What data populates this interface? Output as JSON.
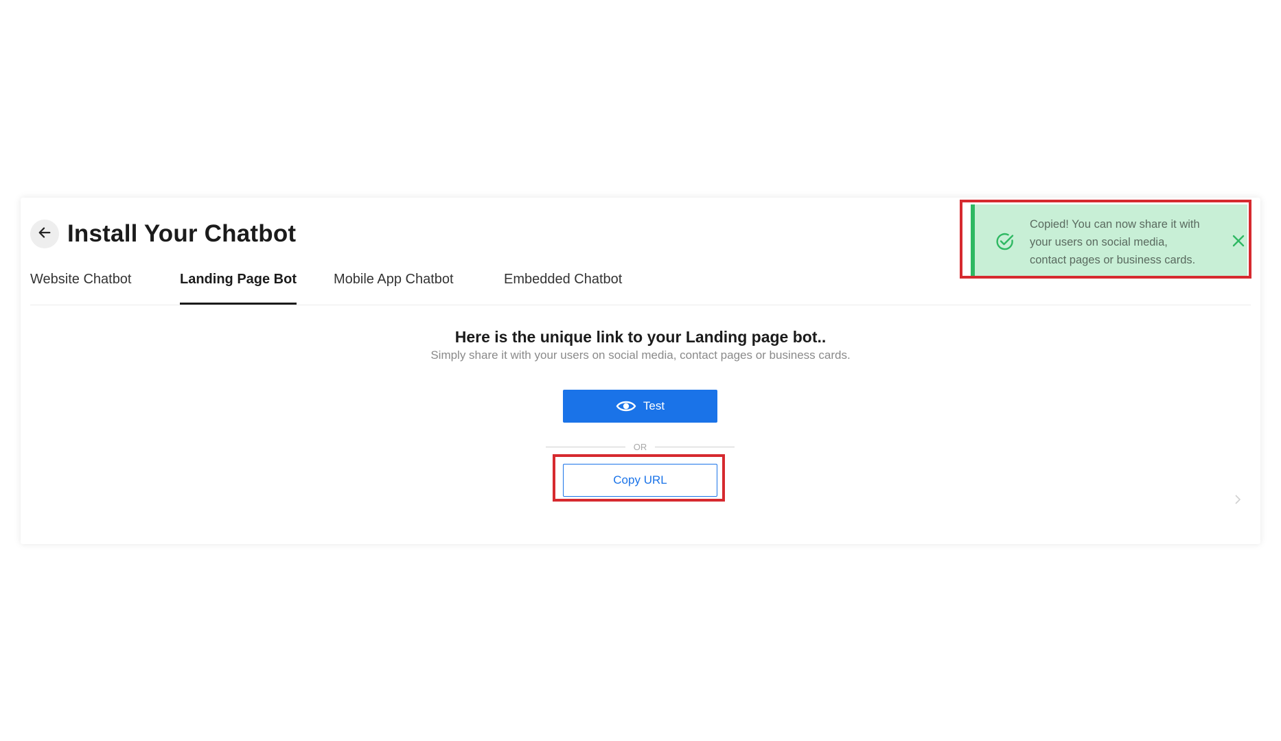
{
  "header": {
    "back_icon": "arrow-left-icon",
    "title": "Install Your Chatbot"
  },
  "tabs": [
    {
      "label": "Website Chatbot",
      "active": false
    },
    {
      "label": "Landing Page Bot",
      "active": true
    },
    {
      "label": "Mobile App Chatbot",
      "active": false
    },
    {
      "label": "Embedded Chatbot",
      "active": false
    }
  ],
  "main": {
    "heading": "Here is the unique link to your Landing page bot..",
    "subheading": "Simply share it with your users on social media, contact pages or business cards.",
    "test_button": {
      "label": "Test",
      "icon": "eye-icon"
    },
    "divider_text": "OR",
    "copy_button": {
      "label": "Copy URL"
    }
  },
  "toast": {
    "status_icon": "check-circle-icon",
    "lines": [
      "Copied! You can now share it with",
      "your users on social media,",
      "contact pages or business cards."
    ],
    "close_icon": "close-icon"
  },
  "colors": {
    "primary": "#1a73e8",
    "toast_bg": "#c8efd6",
    "toast_accent": "#2eb862",
    "highlight": "#d62a2f"
  }
}
